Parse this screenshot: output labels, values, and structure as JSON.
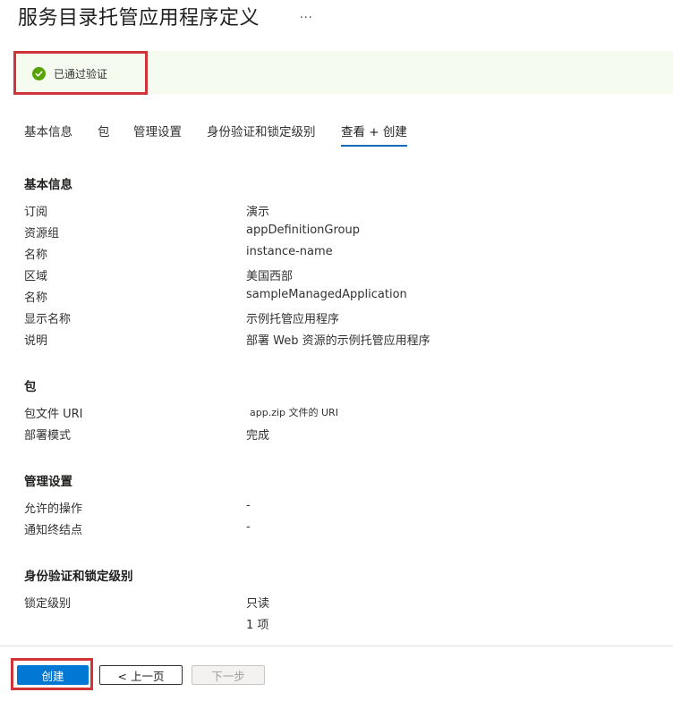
{
  "header": {
    "title": "服务目录托管应用程序定义",
    "more_label": "..."
  },
  "banner": {
    "text": "已通过验证",
    "icon": "check-circle-icon",
    "color": "#57a300"
  },
  "tabs": [
    {
      "label": "基本信息",
      "active": false
    },
    {
      "label": "包",
      "active": false
    },
    {
      "label": "管理设置",
      "active": false
    },
    {
      "label": "身份验证和锁定级别",
      "active": false
    },
    {
      "label": "查看 + 创建",
      "active": true
    }
  ],
  "sections": {
    "basics": {
      "title": "基本信息",
      "rows": [
        {
          "label": "订阅",
          "value": "演示"
        },
        {
          "label": "资源组",
          "value": "appDefinitionGroup"
        },
        {
          "label": "名称",
          "value": "instance-name"
        },
        {
          "label": "区域",
          "value": "美国西部"
        },
        {
          "label": "名称",
          "value": "sampleManagedApplication"
        },
        {
          "label": "显示名称",
          "value": "示例托管应用程序"
        },
        {
          "label": "说明",
          "value": "部署 Web 资源的示例托管应用程序"
        }
      ]
    },
    "package": {
      "title": "包",
      "rows": [
        {
          "label": "包文件 URI",
          "value": "app.zip 文件的 URI"
        },
        {
          "label": "部署模式",
          "value": "完成"
        }
      ]
    },
    "management": {
      "title": "管理设置",
      "rows": [
        {
          "label": "允许的操作",
          "value": "-"
        },
        {
          "label": "通知终结点",
          "value": "-"
        }
      ]
    },
    "auth": {
      "title": "身份验证和锁定级别",
      "rows": [
        {
          "label": "锁定级别",
          "value": "只读"
        }
      ],
      "extra_value": "1 项"
    }
  },
  "footer": {
    "create_label": "创建",
    "prev_label": "< 上一页",
    "next_label": "下一步"
  },
  "colors": {
    "accent": "#0078d4",
    "highlight": "#d13438",
    "success": "#57a300",
    "banner_bg": "#f6fbef"
  }
}
